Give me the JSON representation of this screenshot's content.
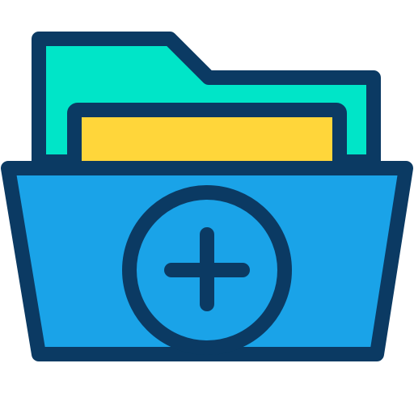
{
  "icon": {
    "name": "add-folder-icon",
    "colors": {
      "outline": "#0b3a63",
      "back_panel": "#00e5c8",
      "paper": "#ffd63a",
      "front_panel": "#1aa3e8",
      "background": "#ffffff"
    }
  }
}
